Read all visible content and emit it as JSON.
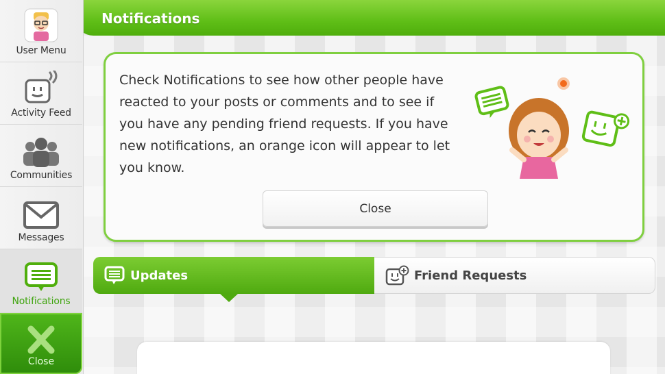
{
  "header": {
    "title": "Notifications"
  },
  "sidebar": {
    "items": [
      {
        "label": "User Menu",
        "icon": "user-avatar-icon"
      },
      {
        "label": "Activity Feed",
        "icon": "activity-feed-icon"
      },
      {
        "label": "Communities",
        "icon": "communities-icon"
      },
      {
        "label": "Messages",
        "icon": "envelope-icon"
      },
      {
        "label": "Notifications",
        "icon": "notification-speech-icon"
      }
    ],
    "close_label": "Close"
  },
  "dialog": {
    "message": "Check Notifications to see how other people have reacted to your posts or comments and to see if you have any pending friend requests. If you have new notifications, an orange icon will appear to let you know.",
    "close_label": "Close"
  },
  "tabs": {
    "updates_label": "Updates",
    "friend_requests_label": "Friend Requests"
  },
  "colors": {
    "accent_green": "#5fbe17",
    "orange_indicator": "#f26a1b"
  }
}
